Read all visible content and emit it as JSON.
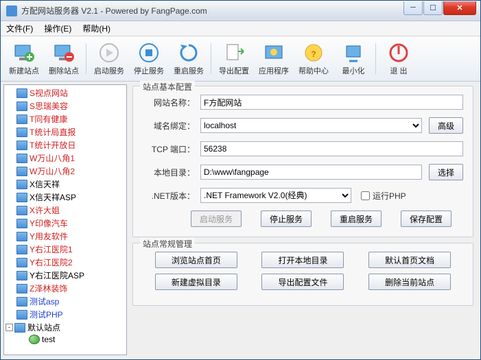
{
  "window": {
    "title": "方配网站服务器 V2.1 - Powered by FangPage.com"
  },
  "menu": {
    "file": "文件(F)",
    "action": "操作(E)",
    "help": "帮助(H)"
  },
  "toolbar": {
    "new_site": "新建站点",
    "del_site": "删除站点",
    "start": "启动服务",
    "stop": "停止服务",
    "restart": "重启服务",
    "export": "导出配置",
    "app": "应用程序",
    "helpcenter": "帮助中心",
    "minimize": "最小化",
    "exit": "退 出"
  },
  "tree": {
    "items": [
      {
        "label": "S视点网站",
        "cls": "red"
      },
      {
        "label": "S思瑞美容",
        "cls": "red"
      },
      {
        "label": "T同有健康",
        "cls": "red"
      },
      {
        "label": "T统计局直报",
        "cls": "red"
      },
      {
        "label": "T统计开放日",
        "cls": "red"
      },
      {
        "label": "W万山八角1",
        "cls": "red"
      },
      {
        "label": "W万山八角2",
        "cls": "red"
      },
      {
        "label": "X信天祥",
        "cls": ""
      },
      {
        "label": "X信天祥ASP",
        "cls": ""
      },
      {
        "label": "X许大姐",
        "cls": "red"
      },
      {
        "label": "Y印像汽车",
        "cls": "red"
      },
      {
        "label": "Y用友软件",
        "cls": "red"
      },
      {
        "label": "Y右江医院1",
        "cls": "red"
      },
      {
        "label": "Y右江医院2",
        "cls": "red"
      },
      {
        "label": "Y右江医院ASP",
        "cls": ""
      },
      {
        "label": "Z泽林装饰",
        "cls": "red"
      },
      {
        "label": "测试asp",
        "cls": "blue"
      },
      {
        "label": "测试PHP",
        "cls": "blue"
      }
    ],
    "default_site": "默认站点",
    "test_child": "test"
  },
  "config": {
    "legend": "站点基本配置",
    "name_label": "网站名称：",
    "name_value": "F方配网站",
    "domain_label": "域名绑定：",
    "domain_value": "localhost",
    "advanced": "高级",
    "port_label": "TCP 端口：",
    "port_value": "56238",
    "dir_label": "本地目录：",
    "dir_value": "D:\\www\\fangpage",
    "choose": "选择",
    "net_label": ".NET版本：",
    "net_value": ".NET Framework V2.0(经典)",
    "runphp": "运行PHP",
    "btn_start": "启动服务",
    "btn_stop": "停止服务",
    "btn_restart": "重启服务",
    "btn_save": "保存配置"
  },
  "manage": {
    "legend": "站点常规管理",
    "browse": "浏览站点首页",
    "opendir": "打开本地目录",
    "defdoc": "默认首页文档",
    "newvdir": "新建虚拟目录",
    "exportcfg": "导出配置文件",
    "delsite": "删除当前站点"
  }
}
